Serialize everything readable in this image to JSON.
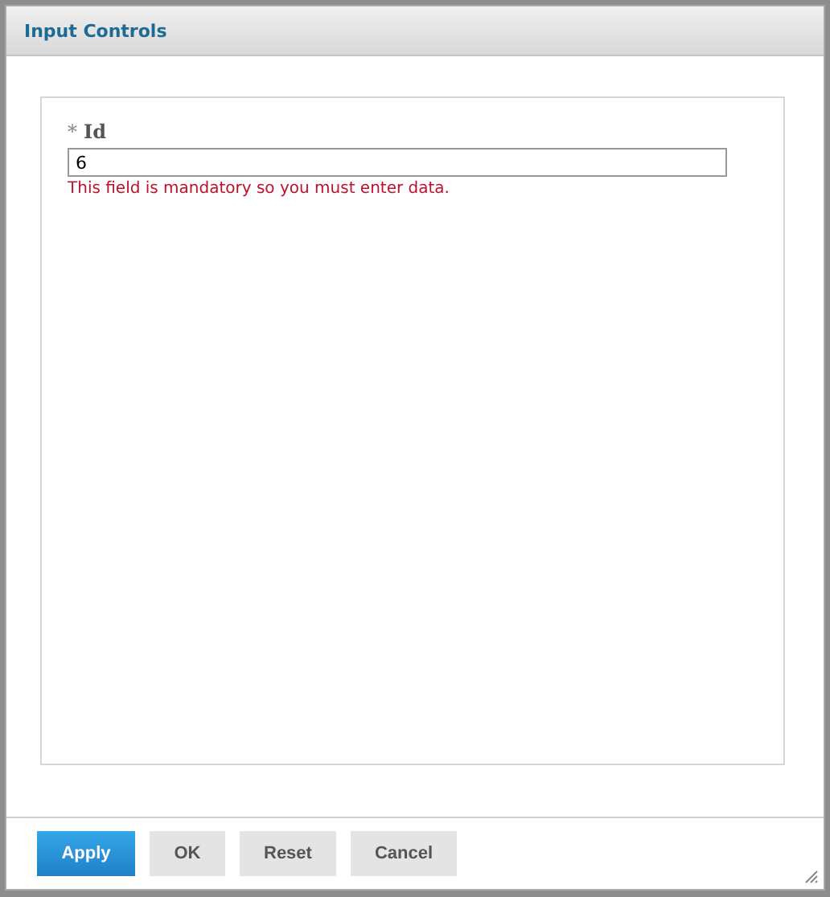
{
  "window": {
    "title": "Input Controls"
  },
  "fields": [
    {
      "label": "Id",
      "required_mark": "*",
      "value": "6",
      "error": "This field is mandatory so you must enter data."
    }
  ],
  "buttons": [
    {
      "label": "Apply",
      "kind": "primary"
    },
    {
      "label": "OK",
      "kind": "secondary"
    },
    {
      "label": "Reset",
      "kind": "secondary"
    },
    {
      "label": "Cancel",
      "kind": "secondary"
    }
  ]
}
